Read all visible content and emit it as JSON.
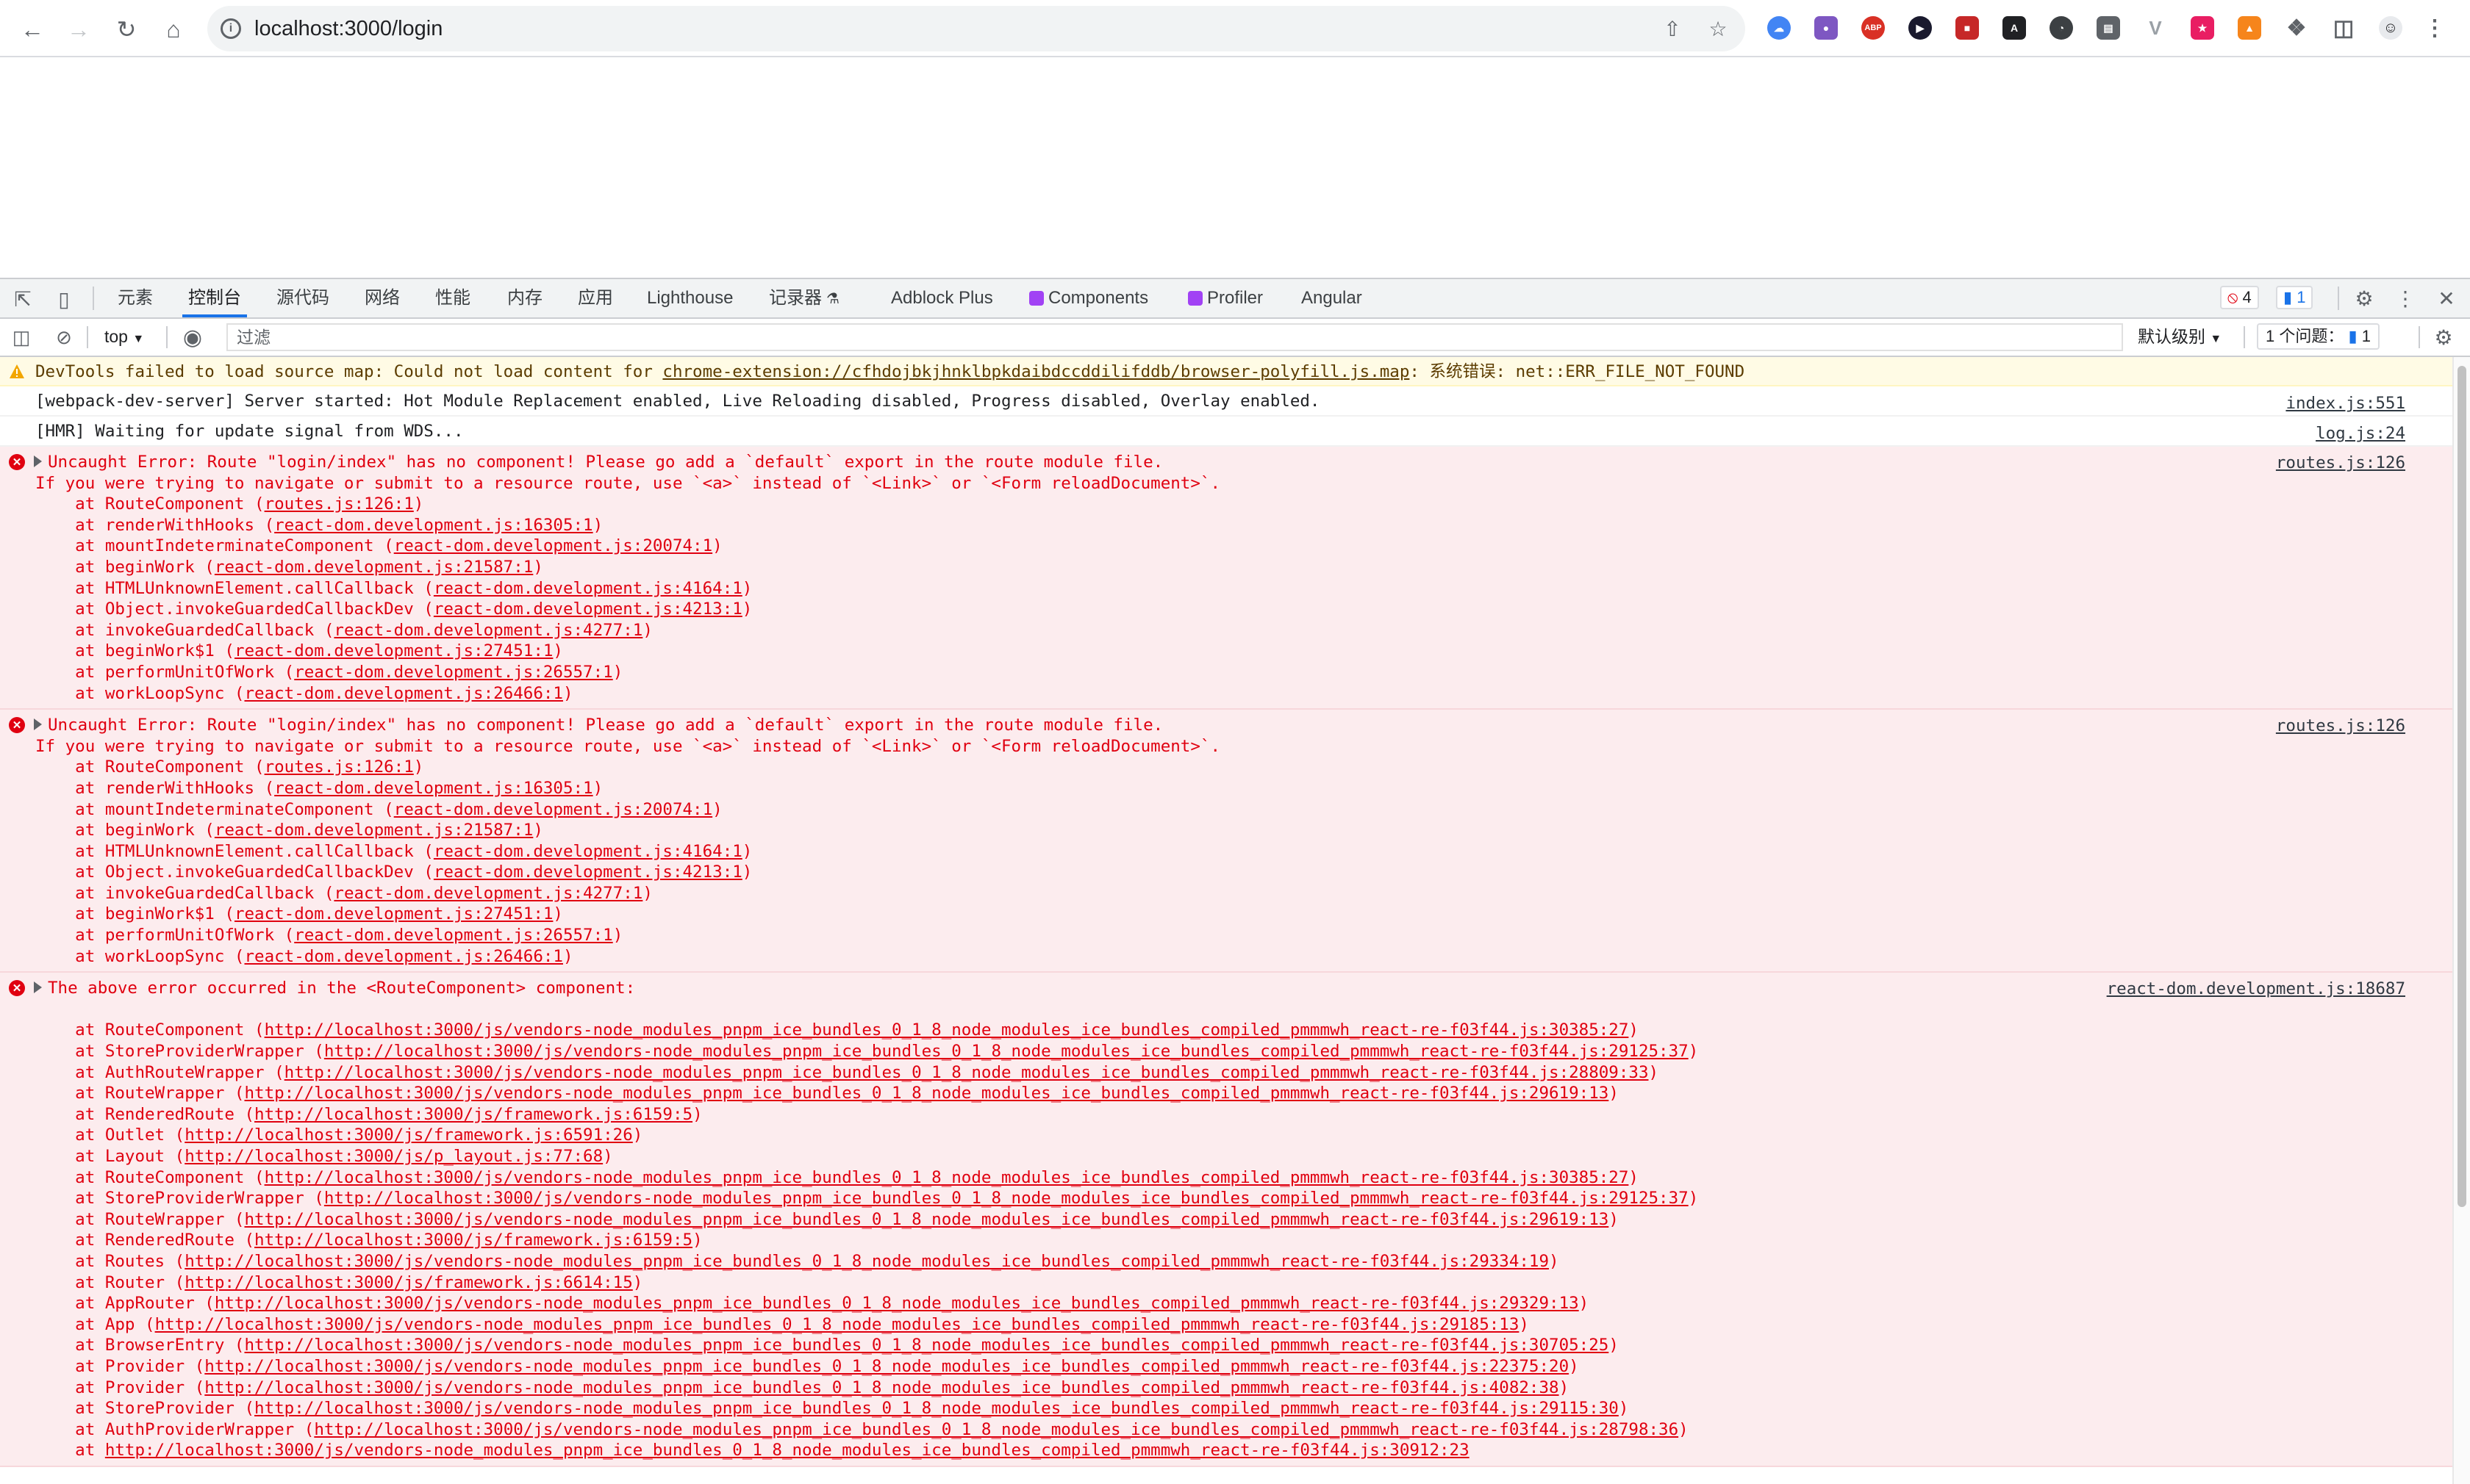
{
  "browser": {
    "url": "localhost:3000/login"
  },
  "devtools": {
    "tabs": [
      "元素",
      "控制台",
      "源代码",
      "网络",
      "性能",
      "内存",
      "应用",
      "Lighthouse",
      "记录器",
      "Adblock Plus",
      "Components",
      "Profiler",
      "Angular"
    ],
    "active_tab": "控制台",
    "error_count": "4",
    "message_count": "1",
    "context": "top",
    "filter_placeholder": "过滤",
    "level": "默认级别",
    "issues_label": "1 个问题：",
    "issues_count": "1"
  },
  "console": {
    "warning": {
      "prefix": "DevTools failed to load source map: Could not load content for ",
      "link": "chrome-extension://cfhdojbkjhnklbpkdaibdccddilifddb/browser-polyfill.js.map",
      "suffix": ": 系统错误: net::ERR_FILE_NOT_FOUND"
    },
    "log1": {
      "text": "[webpack-dev-server] Server started: Hot Module Replacement enabled, Live Reloading disabled, Progress disabled, Overlay enabled.",
      "source": "index.js:551"
    },
    "log2": {
      "text": "[HMR] Waiting for update signal from WDS...",
      "source": "log.js:24"
    },
    "error1": {
      "title": "Uncaught Error: Route \"login/index\" has no component! Please go add a `default` export in the route module file.",
      "line2": "If you were trying to navigate or submit to a resource route, use `<a>` instead of `<Link>` or `<Form reloadDocument>`.",
      "source": "routes.js:126",
      "frames": [
        {
          "fn": "RouteComponent",
          "loc": "routes.js:126:1"
        },
        {
          "fn": "renderWithHooks",
          "loc": "react-dom.development.js:16305:1"
        },
        {
          "fn": "mountIndeterminateComponent",
          "loc": "react-dom.development.js:20074:1"
        },
        {
          "fn": "beginWork",
          "loc": "react-dom.development.js:21587:1"
        },
        {
          "fn": "HTMLUnknownElement.callCallback",
          "loc": "react-dom.development.js:4164:1"
        },
        {
          "fn": "Object.invokeGuardedCallbackDev",
          "loc": "react-dom.development.js:4213:1"
        },
        {
          "fn": "invokeGuardedCallback",
          "loc": "react-dom.development.js:4277:1"
        },
        {
          "fn": "beginWork$1",
          "loc": "react-dom.development.js:27451:1"
        },
        {
          "fn": "performUnitOfWork",
          "loc": "react-dom.development.js:26557:1"
        },
        {
          "fn": "workLoopSync",
          "loc": "react-dom.development.js:26466:1"
        }
      ]
    },
    "error2": {
      "title": "Uncaught Error: Route \"login/index\" has no component! Please go add a `default` export in the route module file.",
      "line2": "If you were trying to navigate or submit to a resource route, use `<a>` instead of `<Link>` or `<Form reloadDocument>`.",
      "source": "routes.js:126",
      "frames": [
        {
          "fn": "RouteComponent",
          "loc": "routes.js:126:1"
        },
        {
          "fn": "renderWithHooks",
          "loc": "react-dom.development.js:16305:1"
        },
        {
          "fn": "mountIndeterminateComponent",
          "loc": "react-dom.development.js:20074:1"
        },
        {
          "fn": "beginWork",
          "loc": "react-dom.development.js:21587:1"
        },
        {
          "fn": "HTMLUnknownElement.callCallback",
          "loc": "react-dom.development.js:4164:1"
        },
        {
          "fn": "Object.invokeGuardedCallbackDev",
          "loc": "react-dom.development.js:4213:1"
        },
        {
          "fn": "invokeGuardedCallback",
          "loc": "react-dom.development.js:4277:1"
        },
        {
          "fn": "beginWork$1",
          "loc": "react-dom.development.js:27451:1"
        },
        {
          "fn": "performUnitOfWork",
          "loc": "react-dom.development.js:26557:1"
        },
        {
          "fn": "workLoopSync",
          "loc": "react-dom.development.js:26466:1"
        }
      ]
    },
    "error3": {
      "title": "The above error occurred in the <RouteComponent> component:",
      "source": "react-dom.development.js:18687",
      "frames": [
        {
          "fn": "RouteComponent",
          "loc": "http://localhost:3000/js/vendors-node_modules_pnpm_ice_bundles_0_1_8_node_modules_ice_bundles_compiled_pmmmwh_react-re-f03f44.js:30385:27"
        },
        {
          "fn": "StoreProviderWrapper",
          "loc": "http://localhost:3000/js/vendors-node_modules_pnpm_ice_bundles_0_1_8_node_modules_ice_bundles_compiled_pmmmwh_react-re-f03f44.js:29125:37"
        },
        {
          "fn": "AuthRouteWrapper",
          "loc": "http://localhost:3000/js/vendors-node_modules_pnpm_ice_bundles_0_1_8_node_modules_ice_bundles_compiled_pmmmwh_react-re-f03f44.js:28809:33"
        },
        {
          "fn": "RouteWrapper",
          "loc": "http://localhost:3000/js/vendors-node_modules_pnpm_ice_bundles_0_1_8_node_modules_ice_bundles_compiled_pmmmwh_react-re-f03f44.js:29619:13"
        },
        {
          "fn": "RenderedRoute",
          "loc": "http://localhost:3000/js/framework.js:6159:5"
        },
        {
          "fn": "Outlet",
          "loc": "http://localhost:3000/js/framework.js:6591:26"
        },
        {
          "fn": "Layout",
          "loc": "http://localhost:3000/js/p_layout.js:77:68"
        },
        {
          "fn": "RouteComponent",
          "loc": "http://localhost:3000/js/vendors-node_modules_pnpm_ice_bundles_0_1_8_node_modules_ice_bundles_compiled_pmmmwh_react-re-f03f44.js:30385:27"
        },
        {
          "fn": "StoreProviderWrapper",
          "loc": "http://localhost:3000/js/vendors-node_modules_pnpm_ice_bundles_0_1_8_node_modules_ice_bundles_compiled_pmmmwh_react-re-f03f44.js:29125:37"
        },
        {
          "fn": "RouteWrapper",
          "loc": "http://localhost:3000/js/vendors-node_modules_pnpm_ice_bundles_0_1_8_node_modules_ice_bundles_compiled_pmmmwh_react-re-f03f44.js:29619:13"
        },
        {
          "fn": "RenderedRoute",
          "loc": "http://localhost:3000/js/framework.js:6159:5"
        },
        {
          "fn": "Routes",
          "loc": "http://localhost:3000/js/vendors-node_modules_pnpm_ice_bundles_0_1_8_node_modules_ice_bundles_compiled_pmmmwh_react-re-f03f44.js:29334:19"
        },
        {
          "fn": "Router",
          "loc": "http://localhost:3000/js/framework.js:6614:15"
        },
        {
          "fn": "AppRouter",
          "loc": "http://localhost:3000/js/vendors-node_modules_pnpm_ice_bundles_0_1_8_node_modules_ice_bundles_compiled_pmmmwh_react-re-f03f44.js:29329:13"
        },
        {
          "fn": "App",
          "loc": "http://localhost:3000/js/vendors-node_modules_pnpm_ice_bundles_0_1_8_node_modules_ice_bundles_compiled_pmmmwh_react-re-f03f44.js:29185:13"
        },
        {
          "fn": "BrowserEntry",
          "loc": "http://localhost:3000/js/vendors-node_modules_pnpm_ice_bundles_0_1_8_node_modules_ice_bundles_compiled_pmmmwh_react-re-f03f44.js:30705:25"
        },
        {
          "fn": "Provider",
          "loc": "http://localhost:3000/js/vendors-node_modules_pnpm_ice_bundles_0_1_8_node_modules_ice_bundles_compiled_pmmmwh_react-re-f03f44.js:22375:20"
        },
        {
          "fn": "Provider",
          "loc": "http://localhost:3000/js/vendors-node_modules_pnpm_ice_bundles_0_1_8_node_modules_ice_bundles_compiled_pmmmwh_react-re-f03f44.js:4082:38"
        },
        {
          "fn": "StoreProvider",
          "loc": "http://localhost:3000/js/vendors-node_modules_pnpm_ice_bundles_0_1_8_node_modules_ice_bundles_compiled_pmmmwh_react-re-f03f44.js:29115:30"
        },
        {
          "fn": "AuthProviderWrapper",
          "loc": "http://localhost:3000/js/vendors-node_modules_pnpm_ice_bundles_0_1_8_node_modules_ice_bundles_compiled_pmmmwh_react-re-f03f44.js:28798:36"
        },
        {
          "fn": "",
          "loc": "http://localhost:3000/js/vendors-node_modules_pnpm_ice_bundles_0_1_8_node_modules_ice_bundles_compiled_pmmmwh_react-re-f03f44.js:30912:23"
        }
      ]
    }
  },
  "colors": {
    "error_text": "#e00010",
    "error_bg": "#fcecee",
    "warning_bg": "#fffbe5",
    "accent": "#1a73e8"
  }
}
